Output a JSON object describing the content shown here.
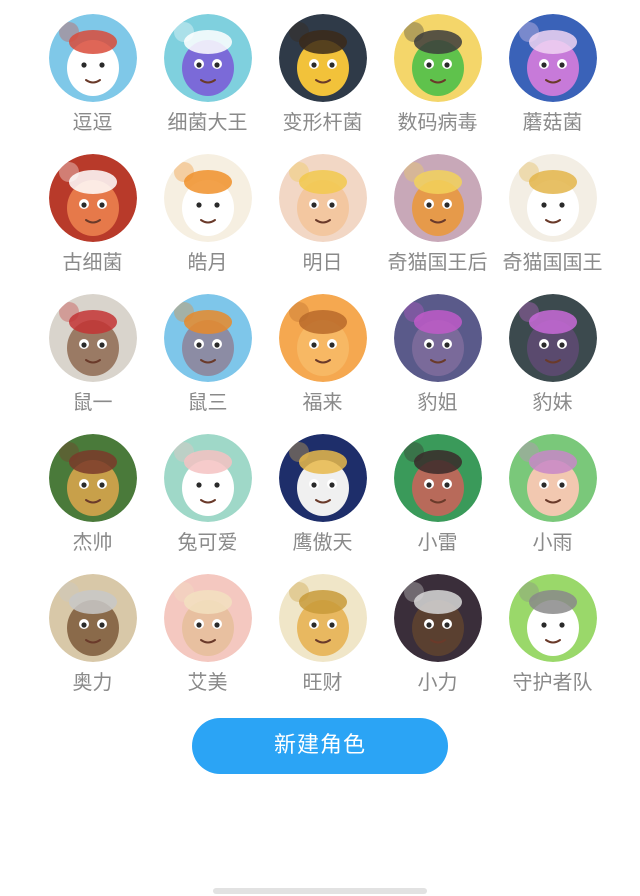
{
  "characters": [
    {
      "name": "逗逗",
      "icon": "bear-cap-avatar-icon",
      "colors": {
        "bg": "#7fc8e8",
        "face": "#ffffff",
        "accent": "#d94b3a"
      }
    },
    {
      "name": "细菌大王",
      "icon": "purple-monster-avatar-icon",
      "colors": {
        "bg": "#7fd0de",
        "face": "#7b6ad8",
        "accent": "#ffffff"
      }
    },
    {
      "name": "变形杆菌",
      "icon": "banana-creature-avatar-icon",
      "colors": {
        "bg": "#2f3a48",
        "face": "#f2c23a",
        "accent": "#3b2a1a"
      }
    },
    {
      "name": "数码病毒",
      "icon": "green-robot-avatar-icon",
      "colors": {
        "bg": "#f4d66a",
        "face": "#5fc24c",
        "accent": "#3c3c3c"
      }
    },
    {
      "name": "蘑菇菌",
      "icon": "mushroom-creature-avatar-icon",
      "colors": {
        "bg": "#3a62b8",
        "face": "#c77ad9",
        "accent": "#f0d5f2"
      }
    },
    {
      "name": "古细菌",
      "icon": "cyclops-elder-avatar-icon",
      "colors": {
        "bg": "#b83a2a",
        "face": "#e6794a",
        "accent": "#ffffff"
      }
    },
    {
      "name": "皓月",
      "icon": "orange-hair-girl-avatar-icon",
      "colors": {
        "bg": "#f6efe1",
        "face": "#ffffff",
        "accent": "#f0912a"
      }
    },
    {
      "name": "明日",
      "icon": "blonde-girl-avatar-icon",
      "colors": {
        "bg": "#f2d7c5",
        "face": "#f3c7a0",
        "accent": "#f2c94c"
      }
    },
    {
      "name": "奇猫国王后",
      "icon": "tiger-queen-avatar-icon",
      "colors": {
        "bg": "#c8a8b8",
        "face": "#e69a4a",
        "accent": "#f2d25a"
      }
    },
    {
      "name": "奇猫国国王",
      "icon": "white-lion-king-avatar-icon",
      "colors": {
        "bg": "#f3eee4",
        "face": "#ffffff",
        "accent": "#e3b54a"
      }
    },
    {
      "name": "鼠一",
      "icon": "basketball-mouse-avatar-icon",
      "colors": {
        "bg": "#d9d4cc",
        "face": "#9a7a64",
        "accent": "#c33434"
      }
    },
    {
      "name": "鼠三",
      "icon": "gray-mouse-avatar-icon",
      "colors": {
        "bg": "#7ec6ea",
        "face": "#8c8ca4",
        "accent": "#e78a2a"
      }
    },
    {
      "name": "福来",
      "icon": "orange-cat-avatar-icon",
      "colors": {
        "bg": "#f5a850",
        "face": "#f7b864",
        "accent": "#b86a2a"
      }
    },
    {
      "name": "豹姐",
      "icon": "leopard-sister-avatar-icon",
      "colors": {
        "bg": "#5a5a8a",
        "face": "#7a6a9a",
        "accent": "#c05ac8"
      }
    },
    {
      "name": "豹妹",
      "icon": "leopard-girl-avatar-icon",
      "colors": {
        "bg": "#3c4a4e",
        "face": "#5a4a6e",
        "accent": "#c86ad8"
      }
    },
    {
      "name": "杰帅",
      "icon": "lion-basketball-avatar-icon",
      "colors": {
        "bg": "#4a7a3a",
        "face": "#c8a04a",
        "accent": "#7a3a2a"
      }
    },
    {
      "name": "兔可爱",
      "icon": "bunny-avatar-icon",
      "colors": {
        "bg": "#9fd8c8",
        "face": "#ffffff",
        "accent": "#f4c2c2"
      }
    },
    {
      "name": "鹰傲天",
      "icon": "eagle-avatar-icon",
      "colors": {
        "bg": "#1e2e6a",
        "face": "#f0f0f0",
        "accent": "#e8b84a"
      }
    },
    {
      "name": "小雷",
      "icon": "boar-avatar-icon",
      "colors": {
        "bg": "#3a9a5a",
        "face": "#b86a5a",
        "accent": "#3a2a2a"
      }
    },
    {
      "name": "小雨",
      "icon": "pink-hair-girl-avatar-icon",
      "colors": {
        "bg": "#7ac87a",
        "face": "#f2c8b0",
        "accent": "#c887c8"
      }
    },
    {
      "name": "奥力",
      "icon": "armored-bear-avatar-icon",
      "colors": {
        "bg": "#d8c8a8",
        "face": "#8a6a4a",
        "accent": "#c8c8c8"
      }
    },
    {
      "name": "艾美",
      "icon": "blonde-woman-avatar-icon",
      "colors": {
        "bg": "#f4c8c0",
        "face": "#e8c0a0",
        "accent": "#f2e0c0"
      }
    },
    {
      "name": "旺财",
      "icon": "golden-dog-avatar-icon",
      "colors": {
        "bg": "#f0e6c8",
        "face": "#e8b860",
        "accent": "#c89a3a"
      }
    },
    {
      "name": "小力",
      "icon": "black-bear-avatar-icon",
      "colors": {
        "bg": "#3a2e3a",
        "face": "#5a4030",
        "accent": "#d8d8d8"
      }
    },
    {
      "name": "守护者队",
      "icon": "guardian-group-avatar-icon",
      "colors": {
        "bg": "#9ad86a",
        "face": "#ffffff",
        "accent": "#8a8a8a"
      }
    }
  ],
  "new_character_button": {
    "label": "新建角色",
    "color": "#2ba4f5"
  }
}
